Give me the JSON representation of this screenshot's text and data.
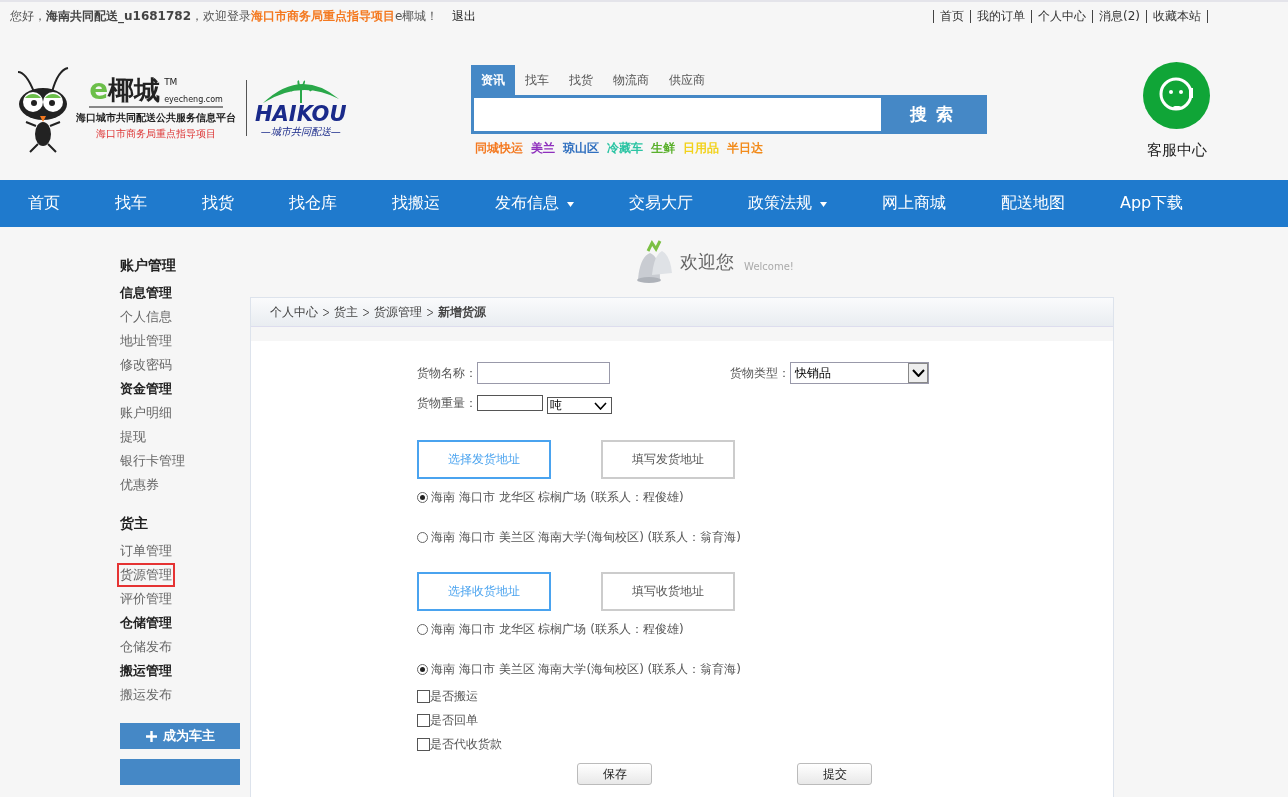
{
  "top_bar": {
    "greeting": "您好，",
    "username": "海南共同配送_u1681782",
    "welcome_prefix": "，欢迎登录",
    "project": "海口市商务局重点指导项目",
    "welcome_suffix": "e椰城！",
    "logout": "退出",
    "links": [
      "首页",
      "我的订单",
      "个人中心",
      "消息(2)",
      "收藏本站"
    ]
  },
  "logo": {
    "e": "e",
    "name": "椰城",
    "tm": "TM",
    "domain": "eyecheng.com",
    "platform": "海口城市共同配送公共服务信息平台",
    "slogan": "海口市商务局重点指导项目",
    "haikou": "HAIKOU",
    "haikou_sub": "—城市共同配送—"
  },
  "search": {
    "tabs": [
      {
        "label": "资讯",
        "selected": true
      },
      {
        "label": "找车",
        "selected": false
      },
      {
        "label": "找货",
        "selected": false
      },
      {
        "label": "物流商",
        "selected": false
      },
      {
        "label": "供应商",
        "selected": false
      }
    ],
    "button": "搜 索",
    "hot_tags": [
      {
        "label": "同城快运",
        "color": "#f47920"
      },
      {
        "label": "美兰",
        "color": "#8e2fbd"
      },
      {
        "label": "琼山区",
        "color": "#2f6fbf"
      },
      {
        "label": "冷藏车",
        "color": "#2bc4a3"
      },
      {
        "label": "生鲜",
        "color": "#5ab02c"
      },
      {
        "label": "日用品",
        "color": "#f2d21b"
      },
      {
        "label": "半日达",
        "color": "#f28b1b"
      }
    ]
  },
  "service": {
    "label": "客服中心"
  },
  "nav": [
    {
      "label": "首页",
      "dropdown": false
    },
    {
      "label": "找车",
      "dropdown": false
    },
    {
      "label": "找货",
      "dropdown": false
    },
    {
      "label": "找仓库",
      "dropdown": false
    },
    {
      "label": "找搬运",
      "dropdown": false
    },
    {
      "label": "发布信息",
      "dropdown": true
    },
    {
      "label": "交易大厅",
      "dropdown": false
    },
    {
      "label": "政策法规",
      "dropdown": true
    },
    {
      "label": "网上商城",
      "dropdown": false
    },
    {
      "label": "配送地图",
      "dropdown": false
    },
    {
      "label": "App下载",
      "dropdown": false
    }
  ],
  "sidebar": {
    "groups": [
      {
        "title": "账户管理",
        "kind": "major"
      },
      {
        "title": "信息管理",
        "kind": "minor",
        "items": [
          {
            "label": "个人信息",
            "selected": false
          },
          {
            "label": "地址管理",
            "selected": false
          },
          {
            "label": "修改密码",
            "selected": false
          }
        ]
      },
      {
        "title": "资金管理",
        "kind": "minor",
        "items": [
          {
            "label": "账户明细",
            "selected": false
          },
          {
            "label": "提现",
            "selected": false
          },
          {
            "label": "银行卡管理",
            "selected": false
          },
          {
            "label": "优惠券",
            "selected": false
          }
        ]
      },
      {
        "title": "货主",
        "kind": "major",
        "items": [
          {
            "label": "订单管理",
            "selected": false
          },
          {
            "label": "货源管理",
            "selected": true
          },
          {
            "label": "评价管理",
            "selected": false
          }
        ]
      },
      {
        "title": "仓储管理",
        "kind": "minor",
        "items": [
          {
            "label": "仓储发布",
            "selected": false
          }
        ]
      },
      {
        "title": "搬运管理",
        "kind": "minor",
        "items": [
          {
            "label": "搬运发布",
            "selected": false
          }
        ]
      }
    ],
    "button": "成为车主"
  },
  "welcome": {
    "title": "欢迎您",
    "subtitle": "Welcome!"
  },
  "breadcrumb": [
    "个人中心",
    "货主",
    "货源管理",
    "新增货源"
  ],
  "form": {
    "name_label": "货物名称：",
    "type_label": "货物类型：",
    "type_value": "快销品",
    "weight_label": "货物重量：",
    "unit_value": "吨",
    "sender": {
      "options": [
        {
          "label": "选择发货地址",
          "selected": true
        },
        {
          "label": "填写发货地址",
          "selected": false
        }
      ],
      "addresses": [
        {
          "text": "海南 海口市 龙华区 棕榈广场 (联系人：程俊雄)",
          "selected": true
        },
        {
          "text": "海南 海口市 美兰区 海南大学(海甸校区) (联系人：翁育海)",
          "selected": false
        }
      ]
    },
    "receiver": {
      "options": [
        {
          "label": "选择收货地址",
          "selected": true
        },
        {
          "label": "填写收货地址",
          "selected": false
        }
      ],
      "addresses": [
        {
          "text": "海南 海口市 龙华区 棕榈广场 (联系人：程俊雄)",
          "selected": false
        },
        {
          "text": "海南 海口市 美兰区 海南大学(海甸校区) (联系人：翁育海)",
          "selected": true
        }
      ]
    },
    "checkboxes": [
      {
        "label": "是否搬运",
        "checked": false
      },
      {
        "label": "是否回单",
        "checked": false
      },
      {
        "label": "是否代收货款",
        "checked": false
      }
    ],
    "buttons": [
      "保存",
      "提交"
    ]
  }
}
